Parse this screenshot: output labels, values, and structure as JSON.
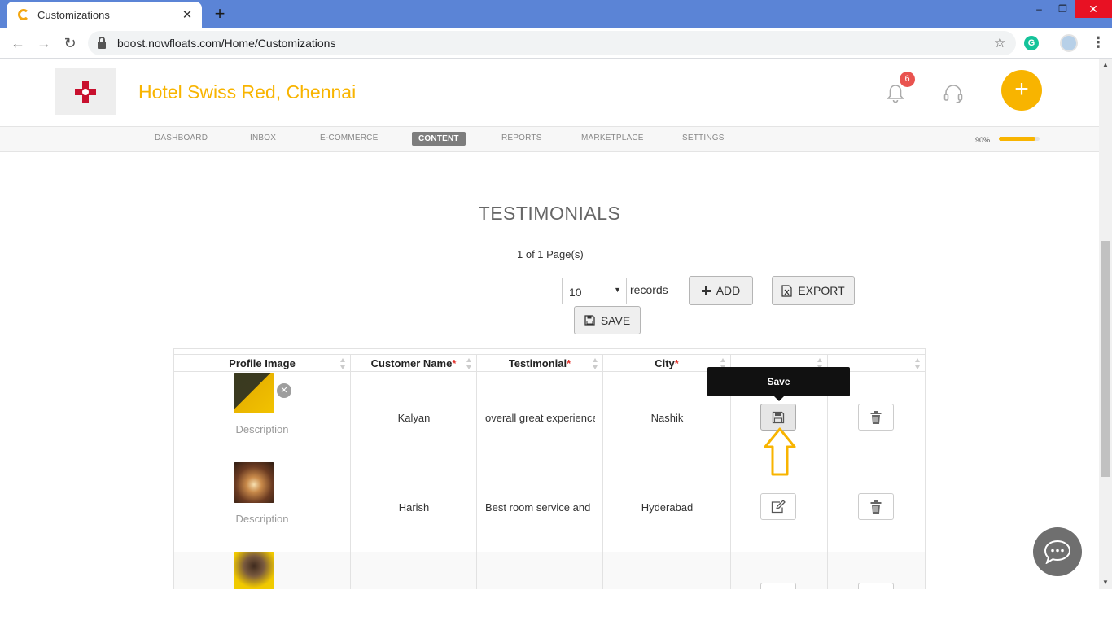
{
  "browser": {
    "tab_title": "Customizations",
    "tab_close": "✕",
    "new_tab": "+",
    "url": "boost.nowfloats.com/Home/Customizations",
    "back": "←",
    "forward": "→",
    "reload": "↻",
    "bookmark": "☆",
    "extension_label": "G",
    "menu": "⋮",
    "window_controls": {
      "minimize": "–",
      "restore": "❐",
      "close": "✕"
    }
  },
  "header": {
    "business_name": "Hotel Swiss Red, Chennai",
    "notification_count": "6",
    "add_button": "+"
  },
  "nav": {
    "items": [
      {
        "label": "DASHBOARD"
      },
      {
        "label": "INBOX"
      },
      {
        "label": "E-COMMERCE"
      },
      {
        "label": "CONTENT"
      },
      {
        "label": "REPORTS"
      },
      {
        "label": "MARKETPLACE"
      },
      {
        "label": "SETTINGS"
      }
    ],
    "active": "CONTENT",
    "progress_label": "90%",
    "progress_value": 0.9
  },
  "page": {
    "title": "TESTIMONIALS",
    "pager": "1 of 1 Page(s)",
    "records_value": "10",
    "records_label": "records",
    "add_label": "ADD",
    "export_label": "EXPORT",
    "save_label": "SAVE"
  },
  "table": {
    "headers": [
      {
        "label": "Profile Image",
        "required": ""
      },
      {
        "label": "Customer Name",
        "required": "*"
      },
      {
        "label": "Testimonial",
        "required": "*"
      },
      {
        "label": "City",
        "required": "*"
      },
      {
        "label": "",
        "required": ""
      },
      {
        "label": "",
        "required": ""
      }
    ],
    "rows": [
      {
        "description": "Description",
        "name": "Kalyan",
        "testimonial": "overall great experience",
        "city": "Nashik"
      },
      {
        "description": "Description",
        "name": "Harish",
        "testimonial": "Best room service and",
        "city": "Hyderabad"
      },
      {
        "description": "",
        "name": "",
        "testimonial": "",
        "city": ""
      }
    ]
  },
  "tooltip": {
    "text": "Save"
  },
  "colors": {
    "brand": "#f8b400",
    "chrome_tab_bar": "#5b84d6",
    "badge": "#e9534f",
    "required": "#e2302a"
  }
}
